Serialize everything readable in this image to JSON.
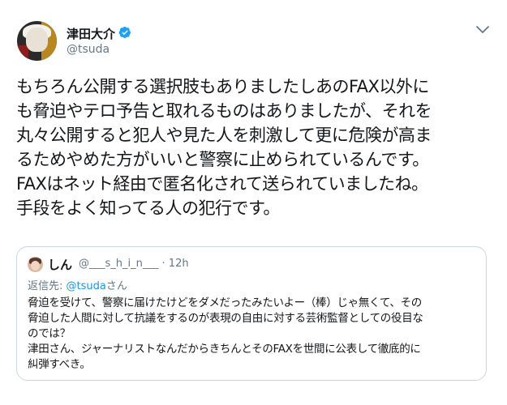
{
  "author": {
    "name": "津田大介",
    "handle": "@tsuda"
  },
  "tweet_lines": [
    "もちろん公開する選択肢もありましたしあのFAX以外に",
    "も脅迫やテロ予告と取れるものはありましたが、それを",
    "丸々公開すると犯人や見た人を刺激して更に危険が高ま",
    "るためやめた方がいいと警察に止められているんです。",
    "FAXはネット経由で匿名化されて送られていましたね。",
    "手段をよく知ってる人の犯行です。"
  ],
  "quoted": {
    "name": "しん",
    "handle": "@___s_h_i_n___",
    "separator": "·",
    "time": "12h",
    "reply_prefix": "返信先: ",
    "reply_to": "@tsuda",
    "reply_suffix": "さん",
    "lines": [
      "脅迫を受けて、警察に届けたけどをダメだったみたいよー（棒）じゃ無くて、その",
      "脅迫した人間に対して抗議をするのが表現の自由に対する芸術監督としての役目な",
      "のでは？",
      "津田さん、ジャーナリストなんだからきちんとそのFAXを世間に公表して徹底的に",
      "糾弾すべき。"
    ]
  },
  "colors": {
    "text": "#14171a",
    "secondary": "#657786",
    "link": "#1b95e0",
    "verified": "#1da1f2",
    "border": "#ccd6dd"
  },
  "icons": {
    "verified": "verified-badge-icon",
    "menu": "chevron-down-icon"
  }
}
